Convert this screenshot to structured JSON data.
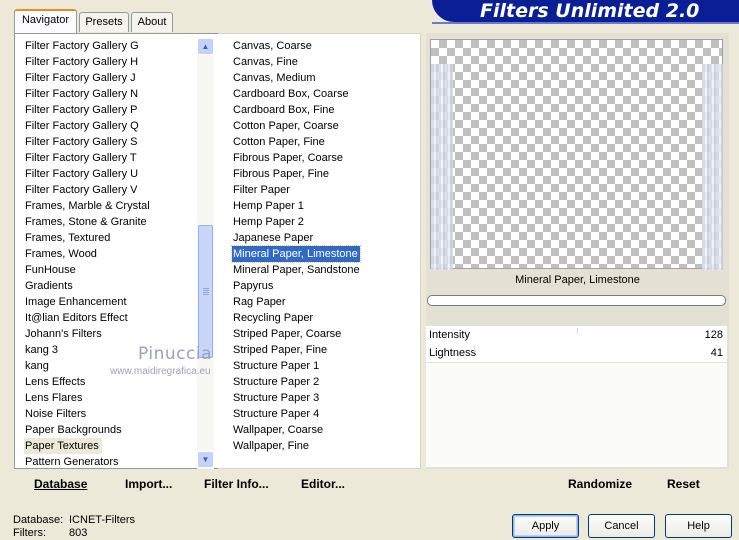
{
  "app": {
    "title": "Filters Unlimited 2.0"
  },
  "tabs": [
    {
      "label": "Navigator",
      "active": true
    },
    {
      "label": "Presets",
      "active": false
    },
    {
      "label": "About",
      "active": false
    }
  ],
  "categories": {
    "items": [
      "Filter Factory Gallery G",
      "Filter Factory Gallery H",
      "Filter Factory Gallery J",
      "Filter Factory Gallery N",
      "Filter Factory Gallery P",
      "Filter Factory Gallery Q",
      "Filter Factory Gallery S",
      "Filter Factory Gallery T",
      "Filter Factory Gallery U",
      "Filter Factory Gallery V",
      "Frames, Marble & Crystal",
      "Frames, Stone & Granite",
      "Frames, Textured",
      "Frames, Wood",
      "FunHouse",
      "Gradients",
      "Image Enhancement",
      "It@lian Editors Effect",
      "Johann's Filters",
      "kang 3",
      "kang",
      "Lens Effects",
      "Lens Flares",
      "Noise Filters",
      "Paper Backgrounds",
      "Paper Textures",
      "Pattern Generators"
    ],
    "selected": "Paper Textures",
    "scroll_up_icon": "arrow-up-icon",
    "scroll_down_icon": "arrow-down-icon"
  },
  "watermark": {
    "name": "Pinuccia",
    "url": "www.maidiregrafica.eu"
  },
  "filters": {
    "items": [
      "Canvas, Coarse",
      "Canvas, Fine",
      "Canvas, Medium",
      "Cardboard Box, Coarse",
      "Cardboard Box, Fine",
      "Cotton Paper, Coarse",
      "Cotton Paper, Fine",
      "Fibrous Paper, Coarse",
      "Fibrous Paper, Fine",
      "Filter Paper",
      "Hemp Paper 1",
      "Hemp Paper 2",
      "Japanese Paper",
      "Mineral Paper, Limestone",
      "Mineral Paper, Sandstone",
      "Papyrus",
      "Rag Paper",
      "Recycling Paper",
      "Striped Paper, Coarse",
      "Striped Paper, Fine",
      "Structure Paper 1",
      "Structure Paper 2",
      "Structure Paper 3",
      "Structure Paper 4",
      "Wallpaper, Coarse",
      "Wallpaper, Fine"
    ],
    "selected": "Mineral Paper, Limestone"
  },
  "preview": {
    "filter_name": "Mineral Paper, Limestone"
  },
  "params": [
    {
      "label": "Intensity",
      "value": "128",
      "fraction": 0.502
    },
    {
      "label": "Lightness",
      "value": "41",
      "fraction": 0.161
    }
  ],
  "toolbar": {
    "database": "Database",
    "import": "Import...",
    "filter_info": "Filter Info...",
    "editor": "Editor...",
    "randomize": "Randomize",
    "reset": "Reset"
  },
  "status": {
    "database_label": "Database:",
    "database_value": "ICNET-Filters",
    "filters_label": "Filters:",
    "filters_value": "803"
  },
  "buttons": {
    "apply": "Apply",
    "cancel": "Cancel",
    "help": "Help"
  },
  "colors": {
    "banner": "#0a1e96",
    "selection": "#316ac5",
    "tab_accent": "#e68b2c"
  }
}
